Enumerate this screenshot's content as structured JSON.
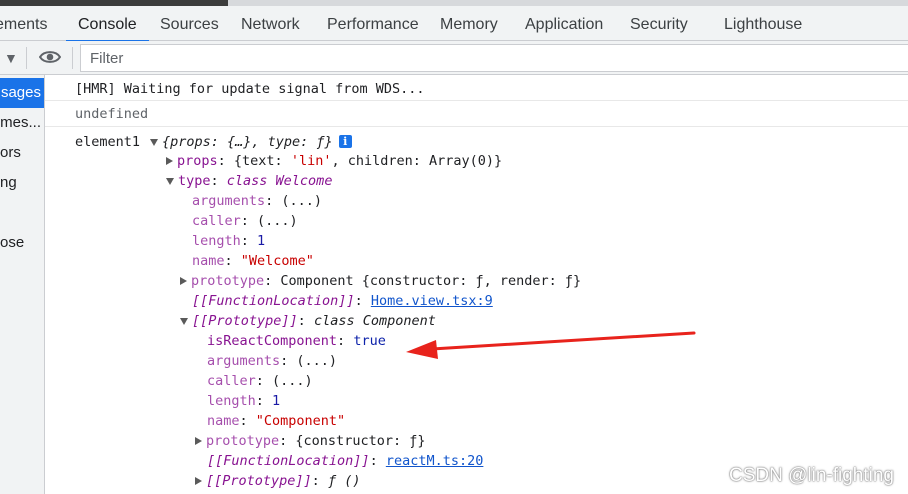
{
  "tabs": [
    {
      "label": "ements"
    },
    {
      "label": "Console"
    },
    {
      "label": "Sources"
    },
    {
      "label": "Network"
    },
    {
      "label": "Performance"
    },
    {
      "label": "Memory"
    },
    {
      "label": "Application"
    },
    {
      "label": "Security"
    },
    {
      "label": "Lighthouse"
    }
  ],
  "active_tab": "Console",
  "toolbar": {
    "filter_placeholder": "Filter"
  },
  "sidebar": {
    "items": [
      {
        "label": "sages"
      },
      {
        "label": "mes..."
      },
      {
        "label": "ors"
      },
      {
        "label": "ng"
      },
      {
        "label": "ose"
      }
    ]
  },
  "console": {
    "hmr": "[HMR] Waiting for update signal from WDS...",
    "undefined": "undefined",
    "element_label": "element1",
    "element_summary": "{props: {…}, type: ƒ}",
    "info_badge": "i",
    "props_key": "props",
    "props_value_pre": "{text: ",
    "props_text_value": "'lin'",
    "props_value_post": ", children: Array(0)}",
    "type_key": "type",
    "type_value": "class Welcome",
    "welcome": {
      "arguments_key": "arguments",
      "arguments_value": "(...)",
      "caller_key": "caller",
      "caller_value": "(...)",
      "length_key": "length",
      "length_value": "1",
      "name_key": "name",
      "name_value": "\"Welcome\"",
      "prototype_key": "prototype",
      "prototype_value": "Component {constructor: ƒ, render: ƒ}",
      "funcloc_key": "[[FunctionLocation]]",
      "funcloc_link": "Home.view.tsx:9",
      "proto_key": "[[Prototype]]",
      "proto_value": "class Component"
    },
    "component": {
      "is_react_key": "isReactComponent",
      "is_react_value": "true",
      "arguments_key": "arguments",
      "arguments_value": "(...)",
      "caller_key": "caller",
      "caller_value": "(...)",
      "length_key": "length",
      "length_value": "1",
      "name_key": "name",
      "name_value": "\"Component\"",
      "prototype_key": "prototype",
      "prototype_value": "{constructor: ƒ}",
      "funcloc_key": "[[FunctionLocation]]",
      "funcloc_link": "reactM.ts:20",
      "proto_key": "[[Prototype]]",
      "proto_value": "ƒ ()"
    }
  },
  "colors": {
    "accent": "#1a73e8",
    "annotation_arrow": "#e8231c"
  },
  "watermark": "CSDN @lin-fighting"
}
